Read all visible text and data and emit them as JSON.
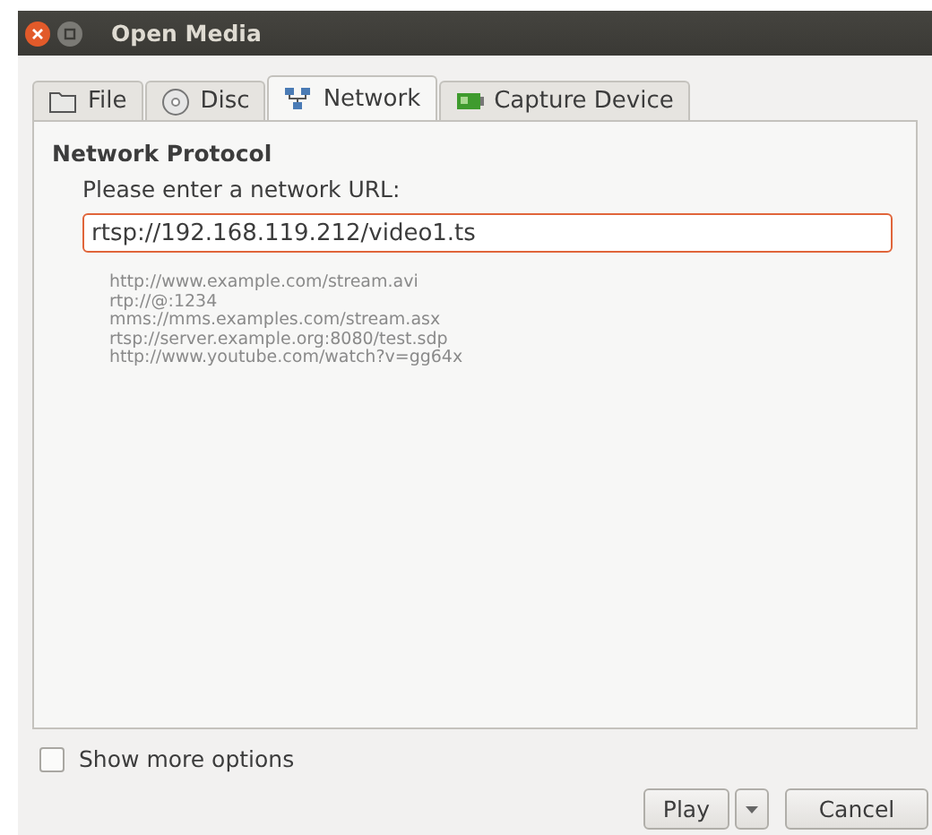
{
  "window": {
    "title": "Open Media"
  },
  "tabs": [
    {
      "label": "File",
      "kind": "folder",
      "selected": false
    },
    {
      "label": "Disc",
      "kind": "disc",
      "selected": false
    },
    {
      "label": "Network",
      "kind": "network",
      "selected": true
    },
    {
      "label": "Capture Device",
      "kind": "capture",
      "selected": false
    }
  ],
  "section_title": "Network Protocol",
  "url_label": "Please enter a network URL:",
  "url_field": {
    "value": "rtsp://192.168.119.212/video1.ts"
  },
  "examples": [
    "http://www.example.com/stream.avi",
    "rtp://@:1234",
    "mms://mms.examples.com/stream.asx",
    "rtsp://server.example.org:8080/test.sdp",
    "http://www.youtube.com/watch?v=gg64x"
  ],
  "more_options": {
    "label": "Show more options",
    "checked": false
  },
  "buttons": {
    "play": "Play",
    "cancel": "Cancel"
  }
}
